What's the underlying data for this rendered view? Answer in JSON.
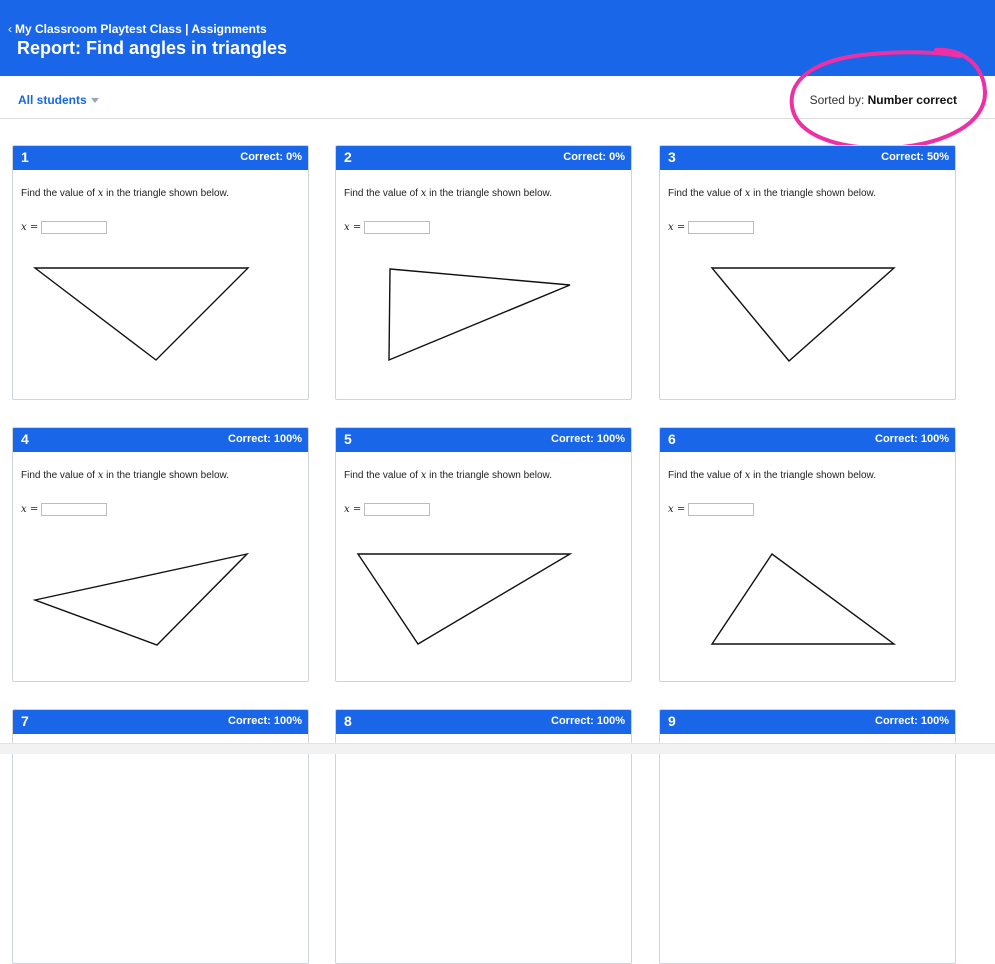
{
  "header": {
    "breadcrumb": "My Classroom Playtest Class | Assignments",
    "title": "Report: Find angles in triangles"
  },
  "filters": {
    "students_label": "All students",
    "sorted_prefix": "Sorted by:",
    "sorted_value": "Number correct"
  },
  "annotation_color": "#ee2fa5",
  "accent": "#1a66e8",
  "questions": [
    {
      "number": "1",
      "correct": "Correct: 0%"
    },
    {
      "number": "2",
      "correct": "Correct: 0%"
    },
    {
      "number": "3",
      "correct": "Correct: 50%"
    },
    {
      "number": "4",
      "correct": "Correct: 100%"
    },
    {
      "number": "5",
      "correct": "Correct: 100%"
    },
    {
      "number": "6",
      "correct": "Correct: 100%"
    },
    {
      "number": "7",
      "correct": "Correct: 100%"
    },
    {
      "number": "8",
      "correct": "Correct: 100%"
    },
    {
      "number": "9",
      "correct": "Correct: 100%"
    }
  ],
  "prompt_before": "Find the value of",
  "prompt_var": "x",
  "prompt_after": "in the triangle shown below.",
  "answer_label": "x ="
}
